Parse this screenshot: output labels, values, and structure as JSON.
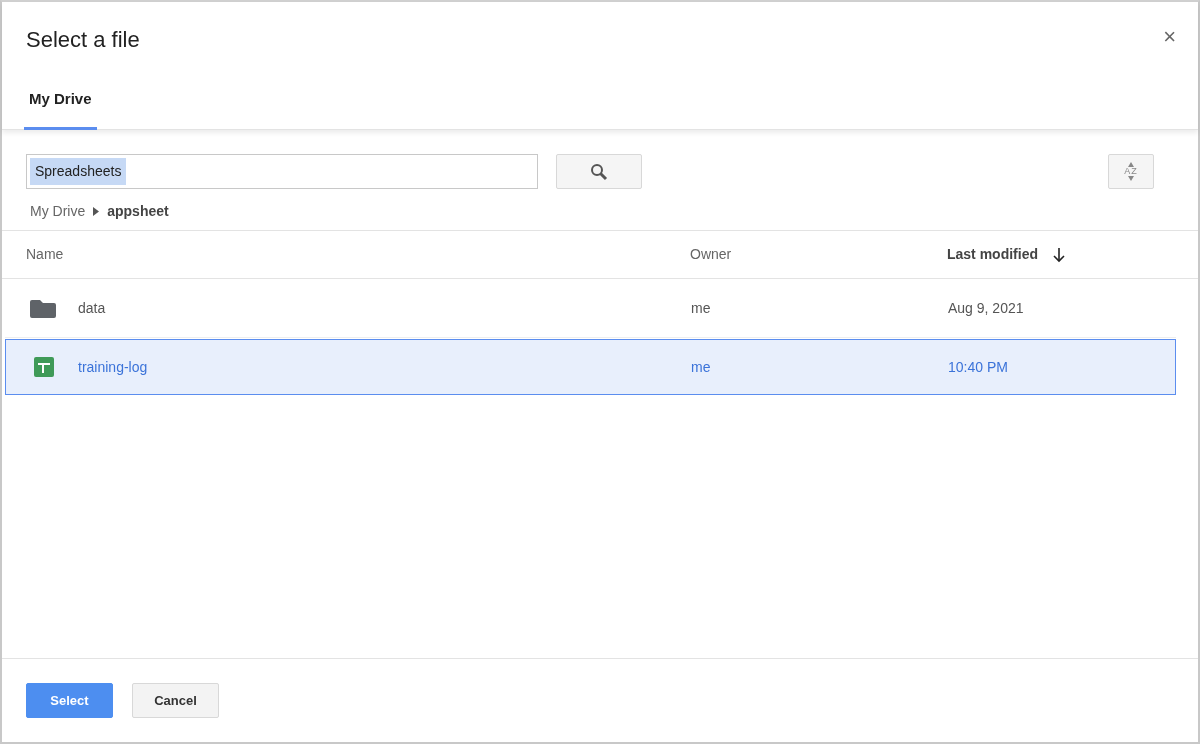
{
  "dialog": {
    "title": "Select a file",
    "close": "×"
  },
  "tabs": [
    {
      "label": "My Drive",
      "selected": true
    }
  ],
  "search": {
    "value": "Spreadsheets",
    "value_selected": true
  },
  "sort_button": {
    "label": "AZ"
  },
  "breadcrumb": [
    "My Drive",
    "appsheet"
  ],
  "table": {
    "columns": [
      {
        "label": "Name",
        "sorted": false
      },
      {
        "label": "Owner",
        "sorted": false
      },
      {
        "label": "Last modified",
        "sorted": true
      }
    ],
    "rows": [
      {
        "kind": "folder",
        "name": "data",
        "owner": "me",
        "modified": "Aug 9, 2021",
        "selected": false
      },
      {
        "kind": "spreadsheet",
        "name": "training-log",
        "owner": "me",
        "modified": "10:40 PM",
        "selected": true
      }
    ]
  },
  "buttons": [
    {
      "label": "Select",
      "kind": "primary"
    },
    {
      "label": "Cancel",
      "kind": "secondary"
    }
  ]
}
